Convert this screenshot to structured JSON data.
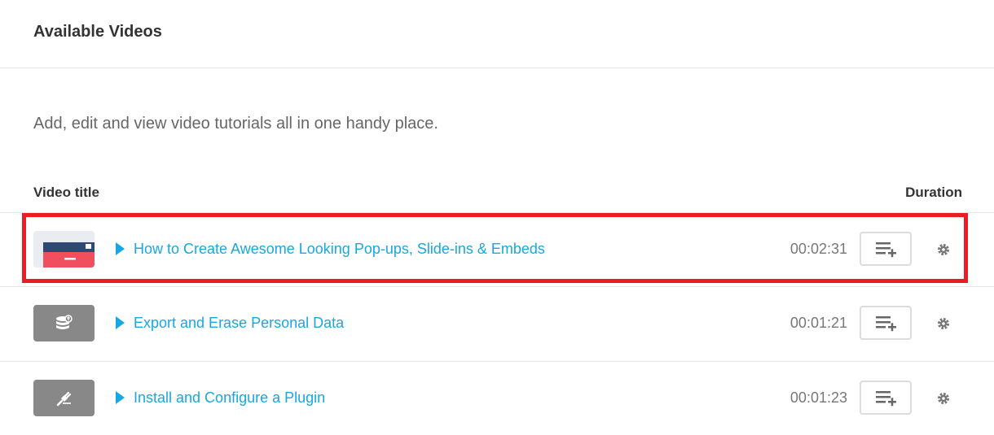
{
  "header": {
    "title": "Available Videos"
  },
  "description": "Add, edit and view video tutorials all in one handy place.",
  "table": {
    "columns": {
      "title": "Video title",
      "duration": "Duration"
    },
    "rows": [
      {
        "title": "How to Create Awesome Looking Pop-ups, Slide-ins & Embeds",
        "duration": "00:02:31",
        "thumbnail_icon": "popup-preview-icon",
        "highlighted": true
      },
      {
        "title": "Export and Erase Personal Data",
        "duration": "00:01:21",
        "thumbnail_icon": "database-export-icon",
        "highlighted": false
      },
      {
        "title": "Install and Configure a Plugin",
        "duration": "00:01:23",
        "thumbnail_icon": "plug-icon",
        "highlighted": false
      }
    ]
  },
  "icons": {
    "play": "play-icon",
    "add_to_playlist": "playlist-add-icon",
    "settings": "gear-icon"
  },
  "colors": {
    "link": "#17a8e3",
    "highlight": "#ec1c24",
    "thumbnail_gray": "#888888"
  }
}
